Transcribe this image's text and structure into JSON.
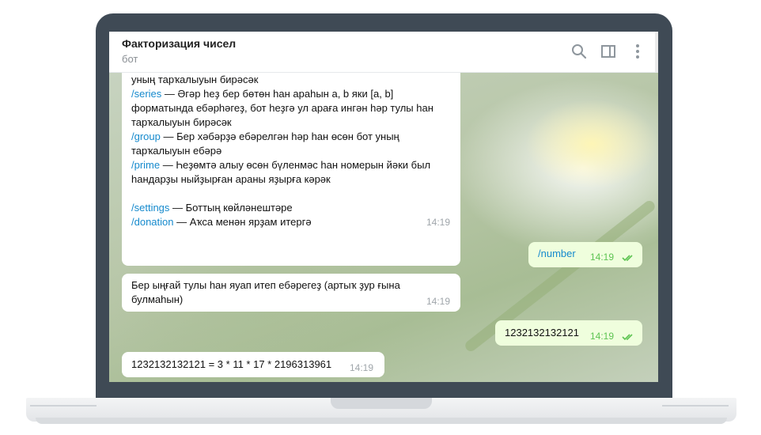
{
  "header": {
    "title": "Факторизация чисел",
    "subtitle": "бот"
  },
  "messages": {
    "help": {
      "lines": [
        {
          "cmd": "",
          "text": "уның тарҡалыуын бирәсәк"
        },
        {
          "cmd": "/series",
          "text": " — Әгәр һеҙ бер бөтөн һан араһын a, b яки [a, b]"
        },
        {
          "cmd": "",
          "text": "форматында ебәрһәгеҙ, бот һеҙгә ул арағa ингән һәр тулы һан"
        },
        {
          "cmd": "",
          "text": "тарҡалыуын бирәсәк"
        },
        {
          "cmd": "/group",
          "text": " — Бер хәбәрҙә ебәрелгән һәр һан өсөн бот уның"
        },
        {
          "cmd": "",
          "text": "тарҡалыуын ебәрә"
        },
        {
          "cmd": "/prime",
          "text": " — Һеҙөмтә алыу өсөн бүленмәс һан номерын йәки был"
        },
        {
          "cmd": "",
          "text": "һандарҙы ныйҙырған араны яҙырға кәрәк"
        },
        {
          "cmd": "/settings",
          "text": " — Боттың көйләнештәре"
        },
        {
          "cmd": "/donation",
          "text": " — Аҡса менән ярҙам итергә"
        }
      ],
      "time": "14:19"
    },
    "out1": {
      "text": "/number",
      "time": "14:19"
    },
    "in2": {
      "lines": [
        "Бер ыңғай тулы һан яуап итеп ебәрегеҙ (артыҡ ҙур ғына",
        "булмаһын)"
      ],
      "time": "14:19"
    },
    "out2": {
      "text": "1232132132121",
      "time": "14:19"
    },
    "in3": {
      "text": "1232132132121 = 3 * 11 * 17 * 2196313961",
      "time": "14:19"
    }
  },
  "icons": {
    "search": "search-icon",
    "sidebar": "sidebar-toggle-icon",
    "more": "more-vertical-icon",
    "read": "double-check-icon"
  },
  "colors": {
    "command": "#168acd",
    "outgoing_bubble": "#effedd",
    "read_check": "#5dc452",
    "laptop_frame": "#3f4a55"
  }
}
